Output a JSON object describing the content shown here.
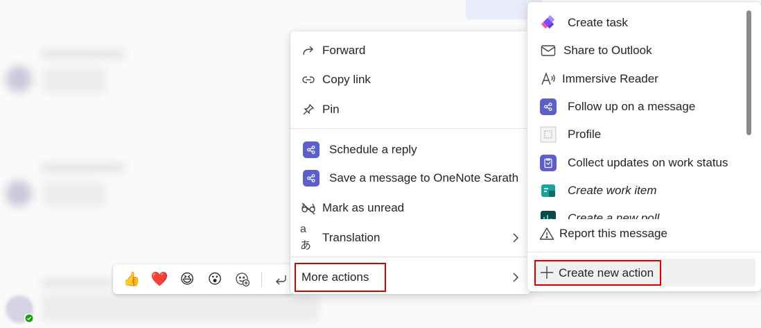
{
  "reactions": {
    "emojis": [
      {
        "name": "thumbs-up-emoji",
        "glyph": "👍"
      },
      {
        "name": "heart-emoji",
        "glyph": "❤️"
      },
      {
        "name": "laughing-emoji",
        "glyph": "😆"
      },
      {
        "name": "surprised-emoji",
        "glyph": "😮"
      }
    ],
    "more_reactions_icon": "smiley-add-icon",
    "reply_icon": "reply-arrow-icon"
  },
  "main_menu": {
    "forward": "Forward",
    "copy_link": "Copy link",
    "pin": "Pin",
    "schedule_reply": "Schedule a reply",
    "save_to_onenote": "Save a message to OneNote Sarath",
    "mark_unread": "Mark as unread",
    "translation": "Translation",
    "more_actions": "More actions"
  },
  "sub_menu": {
    "create_task": "Create task",
    "share_outlook": "Share to Outlook",
    "immersive_reader": "Immersive Reader",
    "follow_up": "Follow up on a message",
    "profile": "Profile",
    "collect_updates": "Collect updates on work status",
    "create_work_item": "Create work item",
    "create_poll_partial": "Create a new poll",
    "report": "Report this message",
    "create_new_action": "Create new action"
  },
  "colors": {
    "accent": "#5b5fc7",
    "highlight_border": "#d40000",
    "presence": "#13a10e"
  }
}
